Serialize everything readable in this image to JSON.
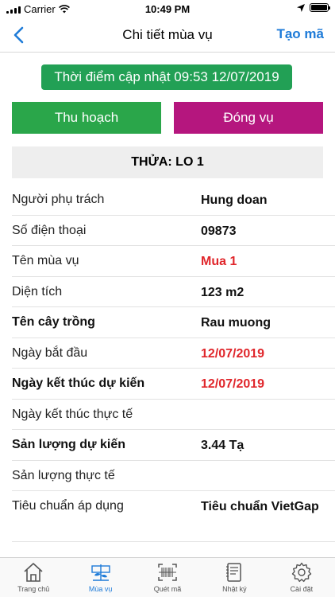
{
  "status_bar": {
    "carrier": "Carrier",
    "time": "10:49 PM"
  },
  "nav": {
    "title": "Chi tiết mùa vụ",
    "action_label": "Tạo mã"
  },
  "update_badge": "Thời điểm cập nhật 09:53 12/07/2019",
  "buttons": {
    "harvest": "Thu hoạch",
    "close": "Đóng vụ"
  },
  "plot_header": "THỬA: LO 1",
  "details": [
    {
      "label": "Người phụ trách",
      "value": "Hung doan"
    },
    {
      "label": "Số điện thoại",
      "value": "09873"
    },
    {
      "label": "Tên mùa vụ",
      "value": "Mua 1"
    },
    {
      "label": "Diện tích",
      "value": "123 m2"
    },
    {
      "label": "Tên cây trồng",
      "value": "Rau muong"
    },
    {
      "label": "Ngày bắt đầu",
      "value": "12/07/2019"
    },
    {
      "label": "Ngày kết thúc dự kiến",
      "value": "12/07/2019"
    },
    {
      "label": "Ngày kết thúc thực tế",
      "value": ""
    },
    {
      "label": "Sản lượng dự kiến",
      "value": "3.44 Tạ"
    },
    {
      "label": "Sản lượng thực tế",
      "value": ""
    },
    {
      "label": "Tiêu chuẩn áp dụng",
      "value": "Tiêu chuẩn VietGap"
    }
  ],
  "tabs": [
    {
      "label": "Trang chủ",
      "icon": "home-icon"
    },
    {
      "label": "Mùa vụ",
      "icon": "sprout-icon"
    },
    {
      "label": "Quét mã",
      "icon": "barcode-icon"
    },
    {
      "label": "Nhật ký",
      "icon": "notebook-icon"
    },
    {
      "label": "Cài đặt",
      "icon": "gear-icon"
    }
  ],
  "colors": {
    "accent": "#1e7bd8",
    "badge_green": "#22a055",
    "harvest_green": "#2aa64a",
    "close_magenta": "#b5167e",
    "date_red": "#e0262b"
  }
}
